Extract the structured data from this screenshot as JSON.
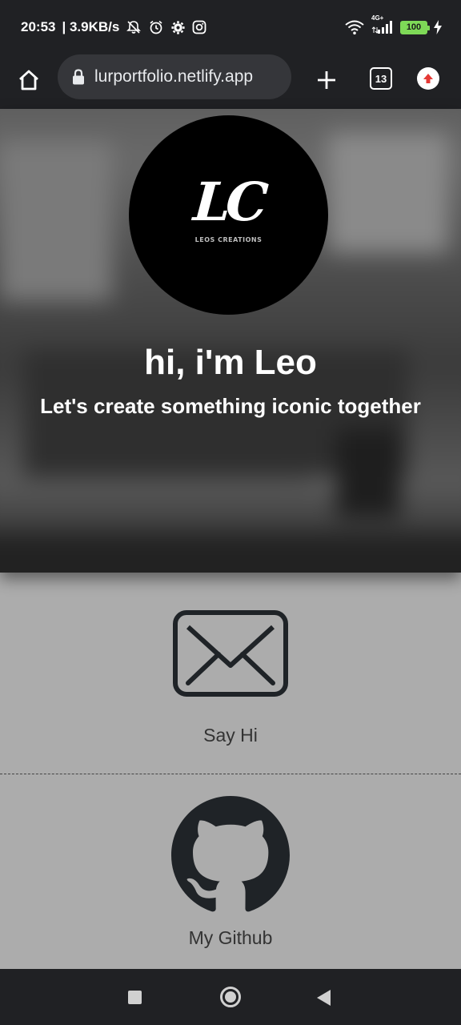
{
  "status_bar": {
    "time": "20:53",
    "speed": "| 3.9KB/s",
    "network": "4G+",
    "battery": "100"
  },
  "browser": {
    "url": "lurportfolio.netlify.app",
    "tab_count": "13"
  },
  "hero": {
    "logo_text": "LC",
    "logo_subtext": "LEOS CREATIONS",
    "title": "hi, i'm Leo",
    "subtitle": "Let's create something iconic together"
  },
  "links": {
    "email_label": "Say Hi",
    "github_label": "My Github"
  },
  "colors": {
    "page_background": "#acacac",
    "system_bar": "#202124",
    "battery": "#7ed957",
    "update_badge": "#e53935"
  }
}
